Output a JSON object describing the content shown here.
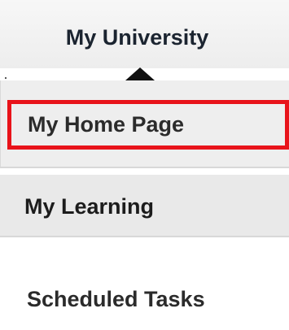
{
  "nav": {
    "title": "My University"
  },
  "menu": {
    "items": [
      {
        "label": "My Home Page"
      },
      {
        "label": "My Learning"
      },
      {
        "label": "Scheduled Tasks"
      }
    ]
  },
  "colors": {
    "highlight_border": "#e8131a",
    "menu_background": "#eeeeee",
    "text": "#2b2b2b"
  },
  "icons": {
    "caret": "caret-up-icon"
  }
}
